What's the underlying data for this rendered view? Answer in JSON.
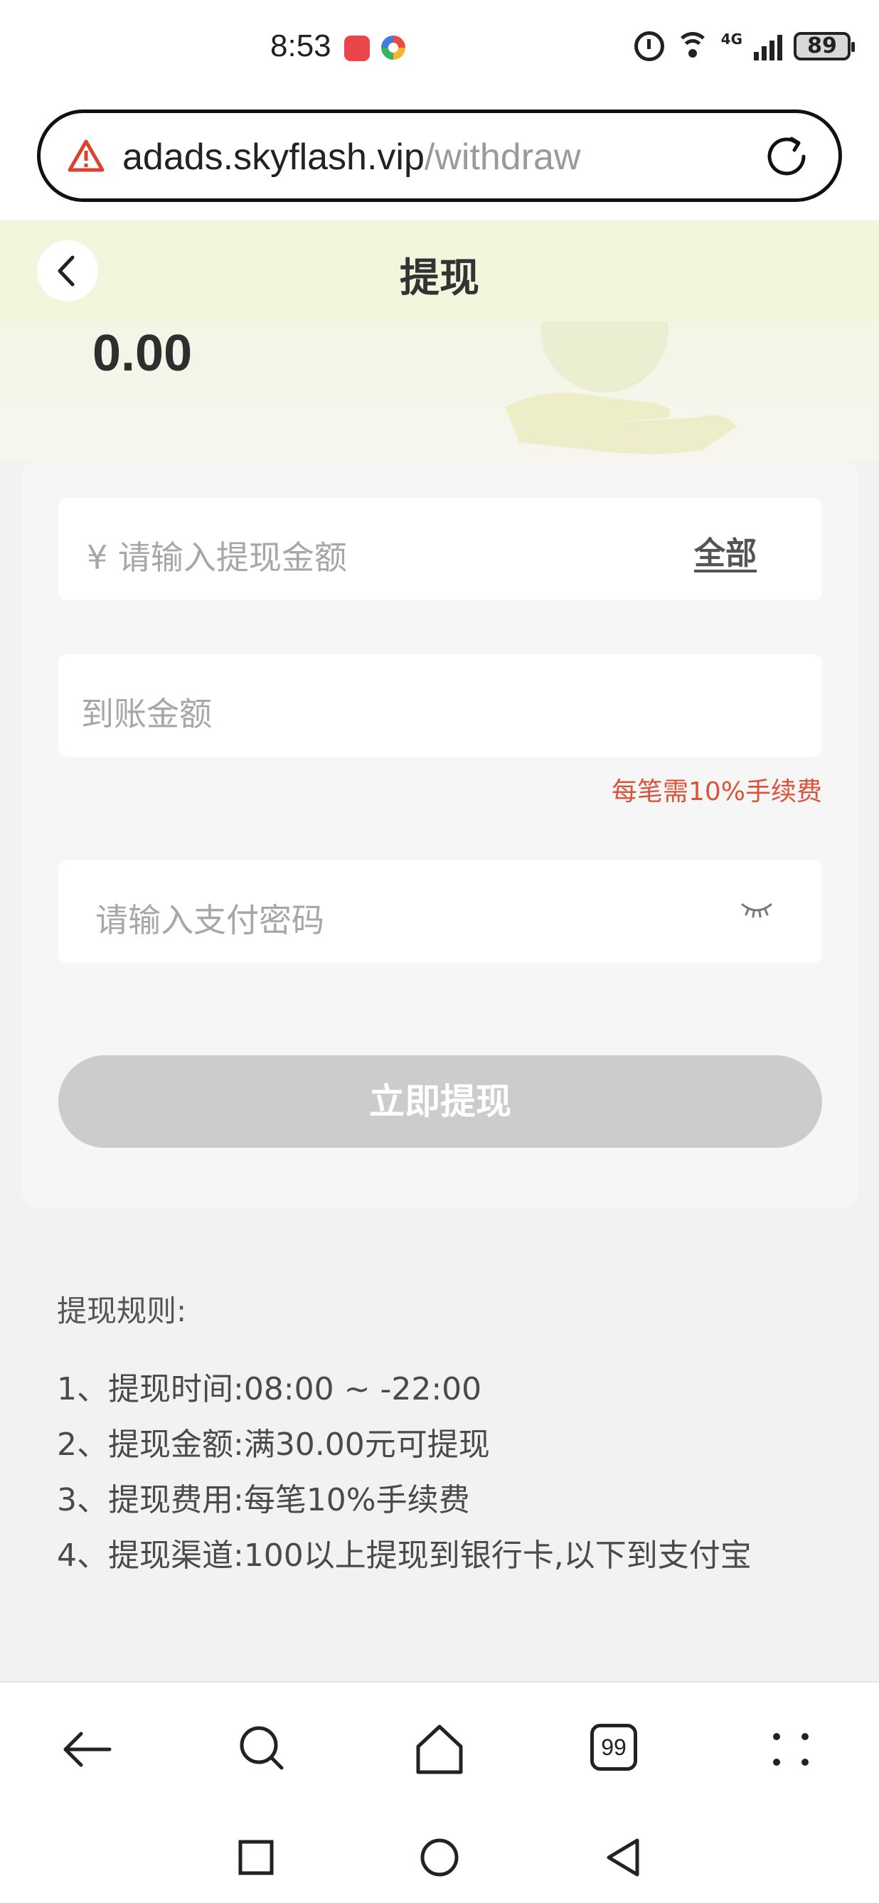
{
  "status_bar": {
    "time": "8:53",
    "network": "4G",
    "battery": "89"
  },
  "browser": {
    "url_host": "adads.skyflash.vip",
    "url_path": "/withdraw",
    "tab_count": "99"
  },
  "header": {
    "title": "提现"
  },
  "balance": {
    "amount": "0.00"
  },
  "form": {
    "amount_placeholder": "¥ 请输入提现金额",
    "all_label": "全部",
    "arrival_placeholder": "到账金额",
    "fee_note": "每笔需10%手续费",
    "password_placeholder": "请输入支付密码",
    "submit_label": "立即提现"
  },
  "rules": {
    "title": "提现规则:",
    "items": [
      "1、提现时间:08:00 ~ -22:00",
      "2、提现金额:满30.00元可提现",
      "3、提现费用:每笔10%手续费",
      "4、提现渠道:100以上提现到银行卡,以下到支付宝"
    ]
  },
  "colors": {
    "header_bg": "#f2f6dc",
    "fee_note": "#d9543b",
    "button_disabled": "#cccccc",
    "page_bg": "#f2f2f2"
  }
}
